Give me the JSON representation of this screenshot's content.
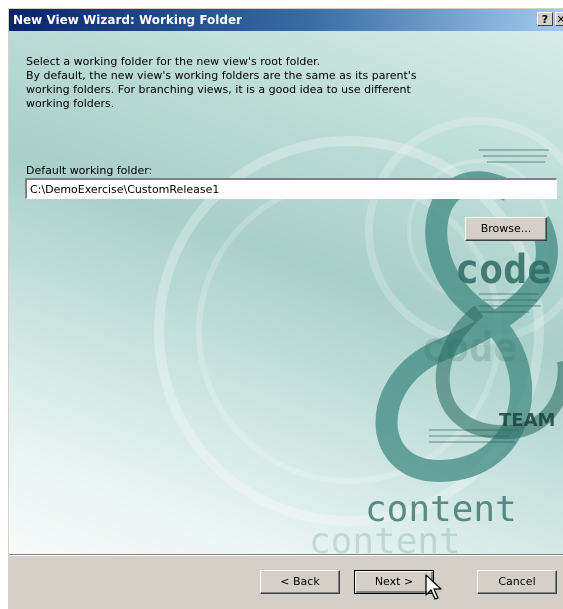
{
  "window": {
    "title": "New View Wizard: Working Folder",
    "help_label": "?",
    "close_label": "✕"
  },
  "intro": {
    "text": "Select a working folder for the new view's root folder.\nBy default, the new view's working folders are the same as its parent's\nworking folders. For branching views, it is a good idea to use different\nworking folders."
  },
  "folder": {
    "label": "Default working folder:",
    "value": "C:\\DemoExercise\\CustomRelease1"
  },
  "buttons": {
    "browse": "Browse...",
    "back": "< Back",
    "next": "Next >",
    "cancel": "Cancel"
  },
  "background_art": {
    "word_code": "code",
    "word_team": "TEAM",
    "word_content": "content"
  },
  "colors": {
    "title_start": "#0a246a",
    "title_end": "#a6caf0",
    "dialog_face": "#d4d0c8",
    "art_teal": "#3f8a82"
  },
  "icons": {
    "cursor": "arrow-cursor-icon"
  }
}
